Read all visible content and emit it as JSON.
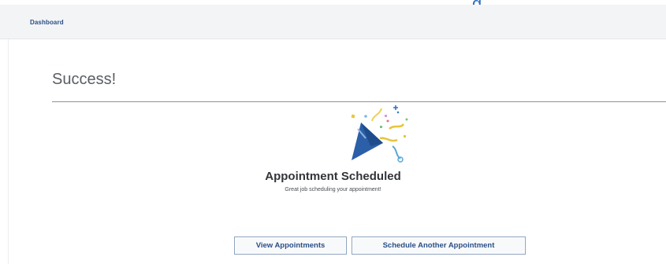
{
  "header": {
    "breadcrumb": "Dashboard"
  },
  "main": {
    "title": "Success!",
    "icon": "party-popper-icon",
    "heading": "Appointment Scheduled",
    "message": "Great job scheduling your appointment!"
  },
  "actions": {
    "view_label": "View Appointments",
    "schedule_label": "Schedule Another Appointment"
  },
  "colors": {
    "accent": "#2a4f86",
    "header_bg": "#f3f4f6",
    "popper_blue": "#2b5fa8",
    "confetti_gold": "#e8c53a"
  }
}
